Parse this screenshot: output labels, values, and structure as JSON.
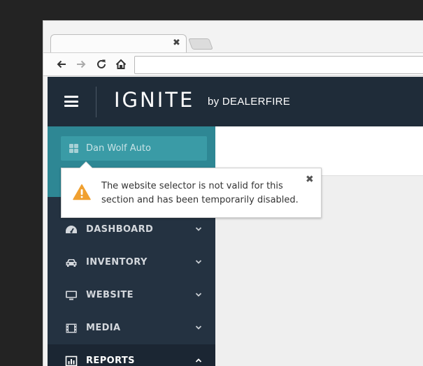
{
  "browser": {
    "tab_close_glyph": "✖"
  },
  "header": {
    "brand": "IGNITE",
    "brand_suffix": "by DEALERFIRE"
  },
  "sidebar": {
    "website_selector": "Dan Wolf Auto",
    "items": [
      {
        "label": "DASHBOARD",
        "icon": "dashboard-icon",
        "chevron": "down"
      },
      {
        "label": "INVENTORY",
        "icon": "car-icon",
        "chevron": "down"
      },
      {
        "label": "WEBSITE",
        "icon": "monitor-icon",
        "chevron": "down"
      },
      {
        "label": "MEDIA",
        "icon": "film-icon",
        "chevron": "down"
      },
      {
        "label": "REPORTS",
        "icon": "bar-chart-icon",
        "chevron": "up"
      }
    ]
  },
  "popover": {
    "message": "The website selector is not valid for this section and has been temporarily disabled.",
    "close_glyph": "✖",
    "icon": "warning-icon"
  },
  "colors": {
    "header_bg": "#1f2c39",
    "sidebar_bg": "#243241",
    "selector_panel": "#2e8794",
    "warning": "#f0a030"
  }
}
